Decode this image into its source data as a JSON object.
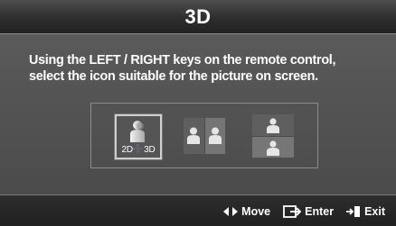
{
  "dialog": {
    "title": "3D",
    "message_line1": "Using the LEFT / RIGHT keys on the remote control,",
    "message_line2": "select the icon suitable for the picture on screen."
  },
  "options": [
    {
      "id": "2d-to-3d",
      "label": "2D➕3D",
      "icon": "person-icon",
      "selected": true
    },
    {
      "id": "side-by-side",
      "label": "",
      "icon": "side-by-side-icon",
      "selected": false
    },
    {
      "id": "top-bottom",
      "label": "",
      "icon": "top-and-bottom-icon",
      "selected": false
    }
  ],
  "footer": {
    "move_label": "Move",
    "enter_label": "Enter",
    "exit_label": "Exit"
  },
  "colors": {
    "panel": "#4b4b4b",
    "title_bar": "#2e2e2e",
    "text": "#ffffff",
    "selection_border": "#cfcfcf"
  }
}
